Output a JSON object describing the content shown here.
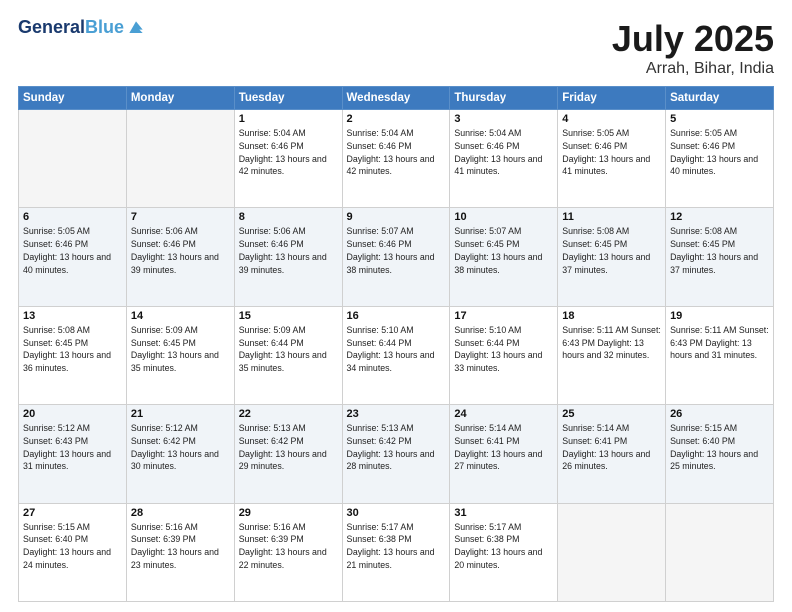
{
  "header": {
    "logo_line1": "General",
    "logo_line2": "Blue",
    "title": "July 2025",
    "subtitle": "Arrah, Bihar, India"
  },
  "weekdays": [
    "Sunday",
    "Monday",
    "Tuesday",
    "Wednesday",
    "Thursday",
    "Friday",
    "Saturday"
  ],
  "weeks": [
    [
      {
        "day": "",
        "info": ""
      },
      {
        "day": "",
        "info": ""
      },
      {
        "day": "1",
        "info": "Sunrise: 5:04 AM\nSunset: 6:46 PM\nDaylight: 13 hours and 42 minutes."
      },
      {
        "day": "2",
        "info": "Sunrise: 5:04 AM\nSunset: 6:46 PM\nDaylight: 13 hours and 42 minutes."
      },
      {
        "day": "3",
        "info": "Sunrise: 5:04 AM\nSunset: 6:46 PM\nDaylight: 13 hours and 41 minutes."
      },
      {
        "day": "4",
        "info": "Sunrise: 5:05 AM\nSunset: 6:46 PM\nDaylight: 13 hours and 41 minutes."
      },
      {
        "day": "5",
        "info": "Sunrise: 5:05 AM\nSunset: 6:46 PM\nDaylight: 13 hours and 40 minutes."
      }
    ],
    [
      {
        "day": "6",
        "info": "Sunrise: 5:05 AM\nSunset: 6:46 PM\nDaylight: 13 hours and 40 minutes."
      },
      {
        "day": "7",
        "info": "Sunrise: 5:06 AM\nSunset: 6:46 PM\nDaylight: 13 hours and 39 minutes."
      },
      {
        "day": "8",
        "info": "Sunrise: 5:06 AM\nSunset: 6:46 PM\nDaylight: 13 hours and 39 minutes."
      },
      {
        "day": "9",
        "info": "Sunrise: 5:07 AM\nSunset: 6:46 PM\nDaylight: 13 hours and 38 minutes."
      },
      {
        "day": "10",
        "info": "Sunrise: 5:07 AM\nSunset: 6:45 PM\nDaylight: 13 hours and 38 minutes."
      },
      {
        "day": "11",
        "info": "Sunrise: 5:08 AM\nSunset: 6:45 PM\nDaylight: 13 hours and 37 minutes."
      },
      {
        "day": "12",
        "info": "Sunrise: 5:08 AM\nSunset: 6:45 PM\nDaylight: 13 hours and 37 minutes."
      }
    ],
    [
      {
        "day": "13",
        "info": "Sunrise: 5:08 AM\nSunset: 6:45 PM\nDaylight: 13 hours and 36 minutes."
      },
      {
        "day": "14",
        "info": "Sunrise: 5:09 AM\nSunset: 6:45 PM\nDaylight: 13 hours and 35 minutes."
      },
      {
        "day": "15",
        "info": "Sunrise: 5:09 AM\nSunset: 6:44 PM\nDaylight: 13 hours and 35 minutes."
      },
      {
        "day": "16",
        "info": "Sunrise: 5:10 AM\nSunset: 6:44 PM\nDaylight: 13 hours and 34 minutes."
      },
      {
        "day": "17",
        "info": "Sunrise: 5:10 AM\nSunset: 6:44 PM\nDaylight: 13 hours and 33 minutes."
      },
      {
        "day": "18",
        "info": "Sunrise: 5:11 AM\nSunset: 6:43 PM\nDaylight: 13 hours and 32 minutes."
      },
      {
        "day": "19",
        "info": "Sunrise: 5:11 AM\nSunset: 6:43 PM\nDaylight: 13 hours and 31 minutes."
      }
    ],
    [
      {
        "day": "20",
        "info": "Sunrise: 5:12 AM\nSunset: 6:43 PM\nDaylight: 13 hours and 31 minutes."
      },
      {
        "day": "21",
        "info": "Sunrise: 5:12 AM\nSunset: 6:42 PM\nDaylight: 13 hours and 30 minutes."
      },
      {
        "day": "22",
        "info": "Sunrise: 5:13 AM\nSunset: 6:42 PM\nDaylight: 13 hours and 29 minutes."
      },
      {
        "day": "23",
        "info": "Sunrise: 5:13 AM\nSunset: 6:42 PM\nDaylight: 13 hours and 28 minutes."
      },
      {
        "day": "24",
        "info": "Sunrise: 5:14 AM\nSunset: 6:41 PM\nDaylight: 13 hours and 27 minutes."
      },
      {
        "day": "25",
        "info": "Sunrise: 5:14 AM\nSunset: 6:41 PM\nDaylight: 13 hours and 26 minutes."
      },
      {
        "day": "26",
        "info": "Sunrise: 5:15 AM\nSunset: 6:40 PM\nDaylight: 13 hours and 25 minutes."
      }
    ],
    [
      {
        "day": "27",
        "info": "Sunrise: 5:15 AM\nSunset: 6:40 PM\nDaylight: 13 hours and 24 minutes."
      },
      {
        "day": "28",
        "info": "Sunrise: 5:16 AM\nSunset: 6:39 PM\nDaylight: 13 hours and 23 minutes."
      },
      {
        "day": "29",
        "info": "Sunrise: 5:16 AM\nSunset: 6:39 PM\nDaylight: 13 hours and 22 minutes."
      },
      {
        "day": "30",
        "info": "Sunrise: 5:17 AM\nSunset: 6:38 PM\nDaylight: 13 hours and 21 minutes."
      },
      {
        "day": "31",
        "info": "Sunrise: 5:17 AM\nSunset: 6:38 PM\nDaylight: 13 hours and 20 minutes."
      },
      {
        "day": "",
        "info": ""
      },
      {
        "day": "",
        "info": ""
      }
    ]
  ]
}
